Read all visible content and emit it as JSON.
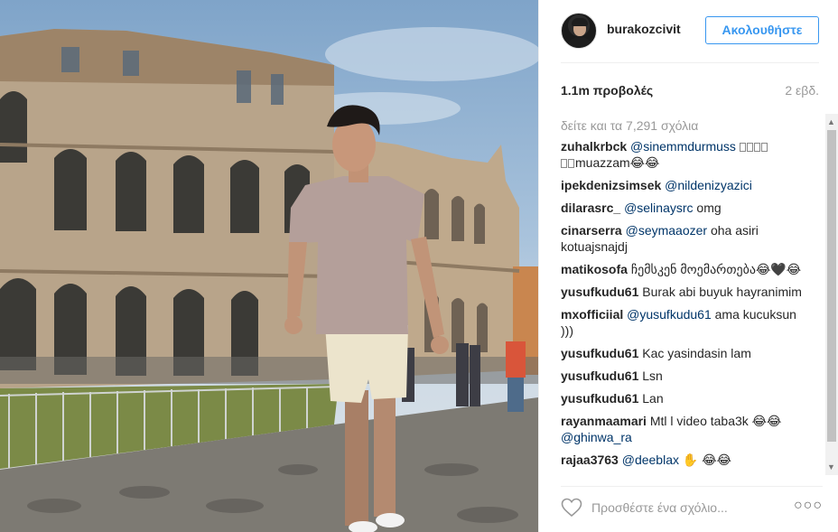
{
  "post": {
    "username": "burakozcivit",
    "follow_label": "Ακολουθήστε",
    "views": "1.1m προβολές",
    "time_ago": "2 εβδ.",
    "load_more": "δείτε και τα 7,291 σχόλια",
    "comment_placeholder": "Προσθέστε ένα σχόλιο...",
    "more_label": "○○○"
  },
  "comments": [
    {
      "user": "zuhalkrbck",
      "mention": "@sinemmdurmuss",
      "boxes_after_mention": 4,
      "boxes_line2": 2,
      "text": "muazzam😂😂"
    },
    {
      "user": "ipekdenizsimsek",
      "mention": "@nildenizyazici",
      "text": ""
    },
    {
      "user": "dilarasrc_",
      "mention": "@selinaysrc",
      "text": " omg"
    },
    {
      "user": "cinarserra",
      "mention": "@seymaaozer",
      "text": " oha asiri kotuajsnajdj"
    },
    {
      "user": "matikosofa",
      "mention": "",
      "text": "ჩემსკენ მოემართება😂🖤😂"
    },
    {
      "user": "yusufkudu61",
      "mention": "",
      "text": "Burak abi buyuk hayranimim"
    },
    {
      "user": "mxofficiial",
      "mention": "@yusufkudu61",
      "text": " ama kucuksun )))"
    },
    {
      "user": "yusufkudu61",
      "mention": "",
      "text": "Kac yasindasin lam"
    },
    {
      "user": "yusufkudu61",
      "mention": "",
      "text": "Lsn"
    },
    {
      "user": "yusufkudu61",
      "mention": "",
      "text": "Lan"
    },
    {
      "user": "rayanmaamari",
      "mention": "",
      "text": "Mtl l video taba3k 😂😂",
      "mention_after": "@ghinwa_ra"
    },
    {
      "user": "rajaa3763",
      "mention": "@deeblax",
      "text": " ✋ 😂😂"
    }
  ]
}
